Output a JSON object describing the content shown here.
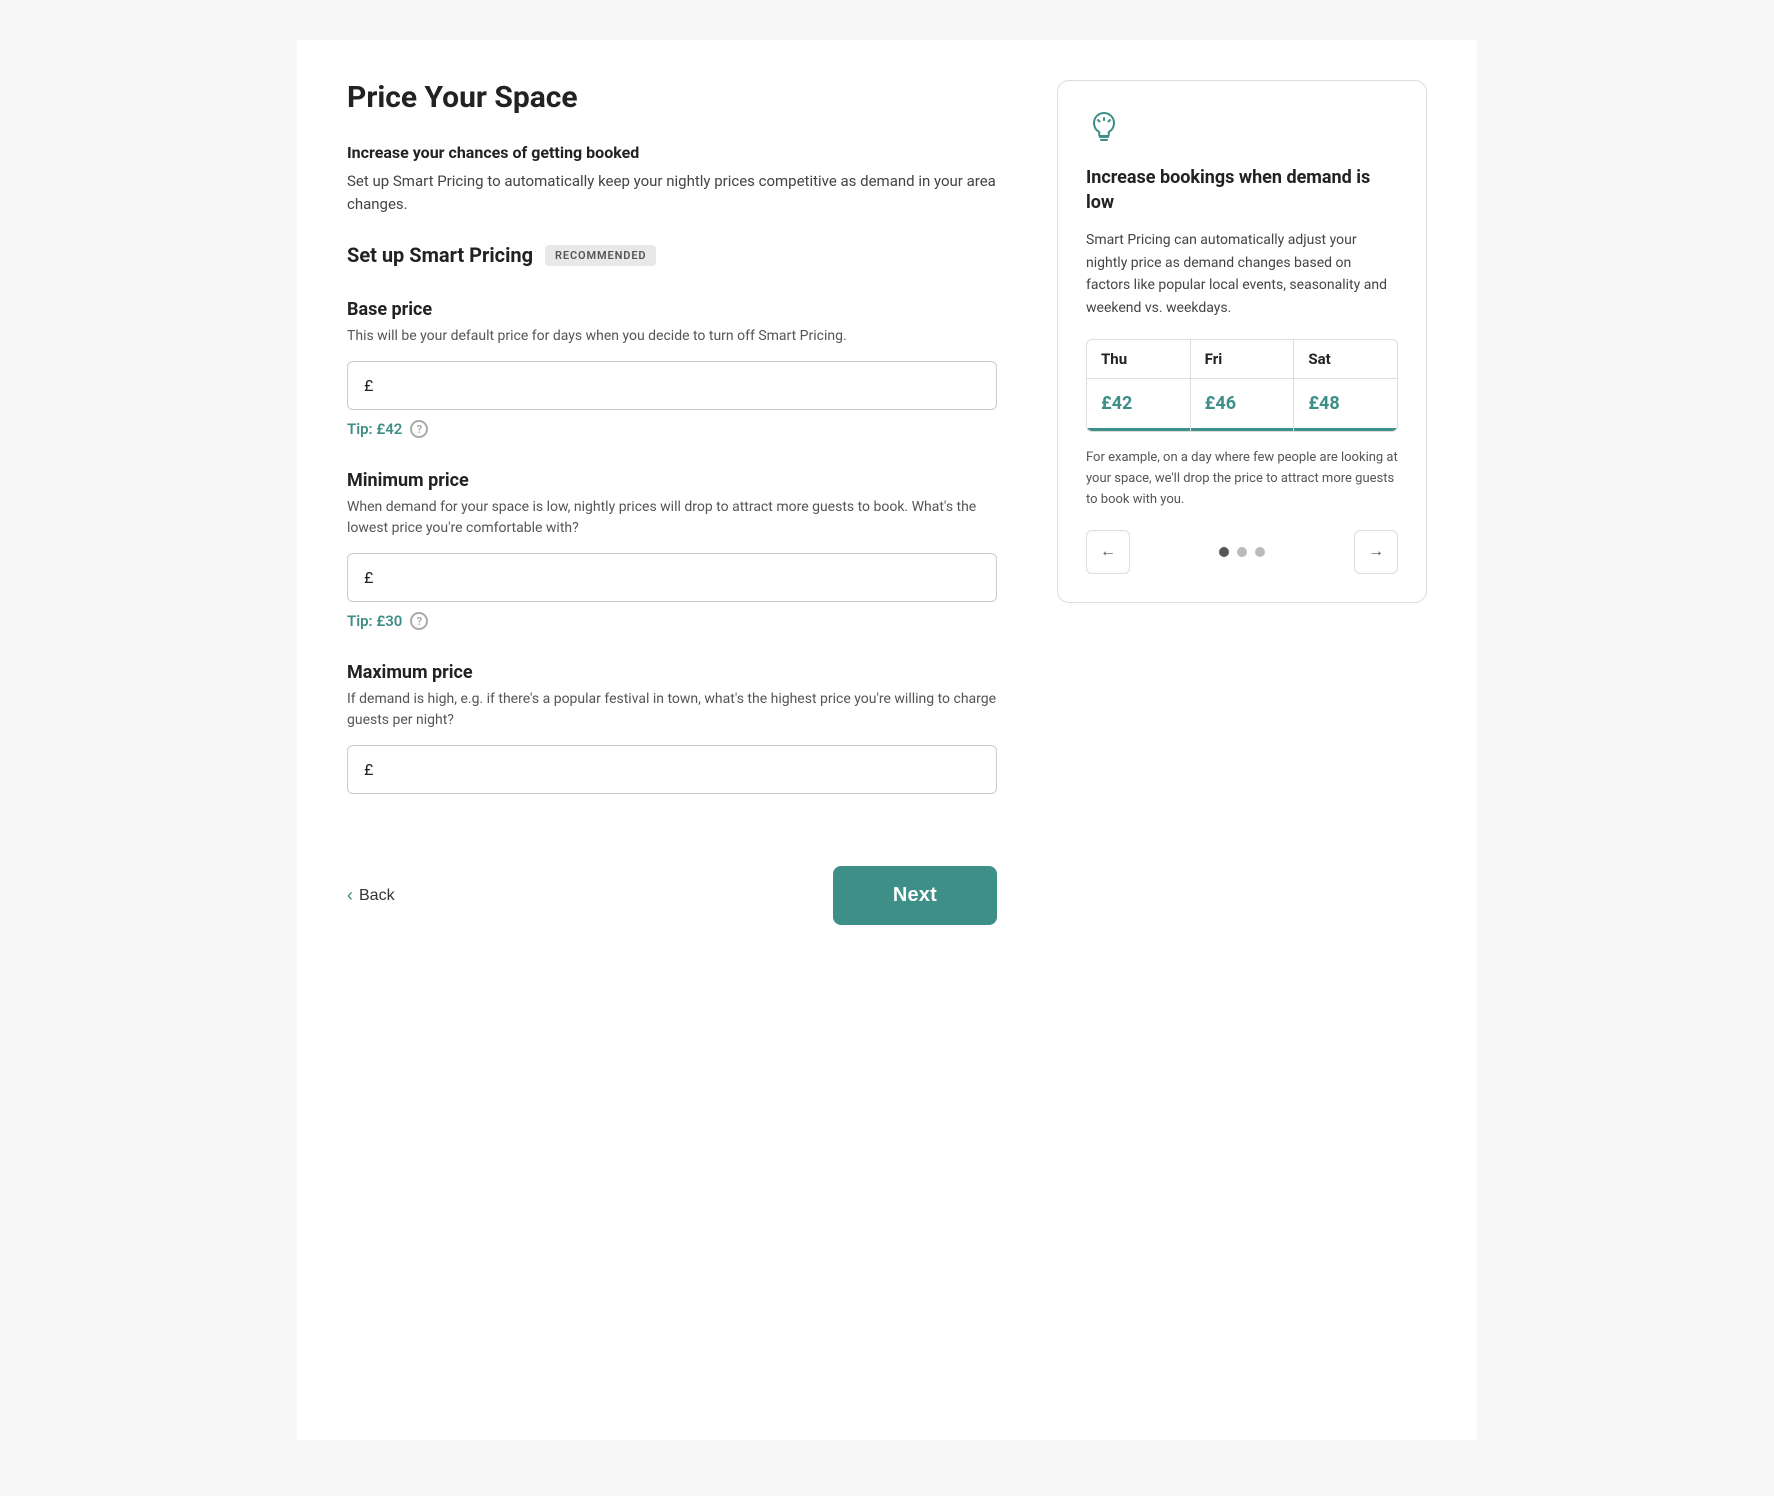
{
  "page": {
    "title": "Price Your Space"
  },
  "increase_section": {
    "heading": "Increase your chances of getting booked",
    "description": "Set up Smart Pricing to automatically keep your nightly prices competitive as demand in your area changes."
  },
  "smart_pricing": {
    "label": "Set up Smart Pricing",
    "badge": "RECOMMENDED"
  },
  "base_price": {
    "title": "Base price",
    "description": "This will be your default price for days when you decide to turn off Smart Pricing.",
    "currency": "£",
    "placeholder": "",
    "tip_label": "Tip: £42",
    "tip_icon": "?"
  },
  "minimum_price": {
    "title": "Minimum price",
    "description": "When demand for your space is low, nightly prices will drop to attract more guests to book. What's the lowest price you're comfortable with?",
    "currency": "£",
    "placeholder": "",
    "tip_label": "Tip: £30",
    "tip_icon": "?"
  },
  "maximum_price": {
    "title": "Maximum price",
    "description": "If demand is high, e.g. if there's a popular festival in town, what's the highest price you're willing to charge guests per night?",
    "currency": "£",
    "placeholder": ""
  },
  "navigation": {
    "back_label": "Back",
    "next_label": "Next"
  },
  "info_card": {
    "title": "Increase bookings when demand is low",
    "description": "Smart Pricing can automatically adjust your nightly price as demand changes based on factors like popular local events, seasonality and weekend vs. weekdays.",
    "note": "For example, on a day where few people are looking at your space, we'll drop the price to attract more guests to book with you.",
    "pricing_cols": [
      {
        "day": "Thu",
        "price": "£42"
      },
      {
        "day": "Fri",
        "price": "£46"
      },
      {
        "day": "Sat",
        "price": "£48"
      }
    ],
    "nav": {
      "prev_icon": "←",
      "next_icon": "→",
      "dots": [
        true,
        false,
        false
      ]
    }
  }
}
